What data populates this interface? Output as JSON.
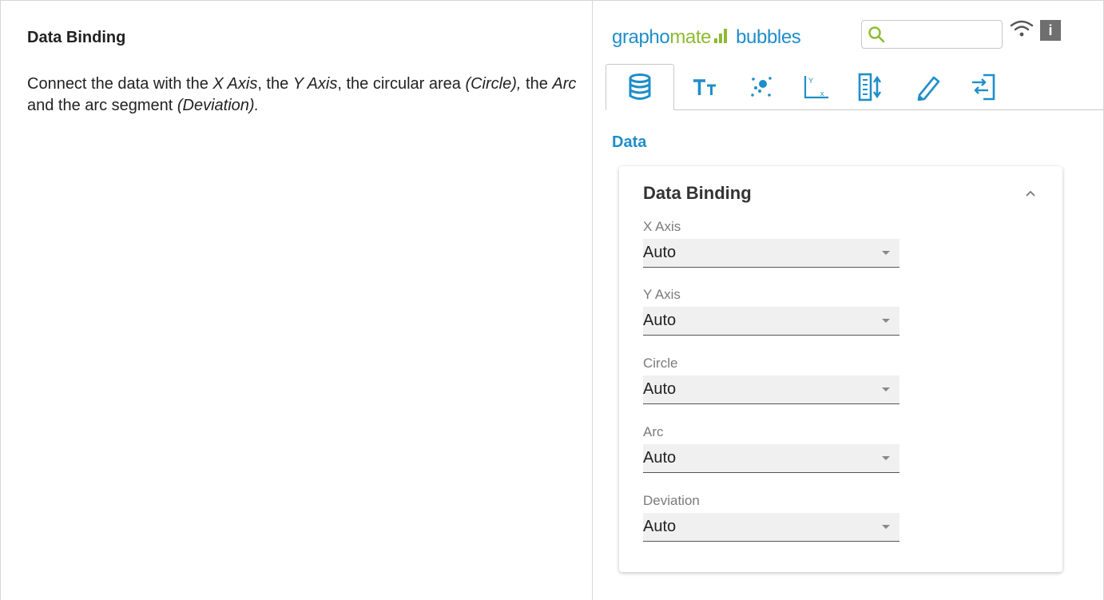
{
  "left": {
    "title": "Data Binding",
    "desc": {
      "t1": "Connect the data with the ",
      "x_axis": "X Axis",
      "t2": ", the ",
      "y_axis": "Y Axis",
      "t3": ", the circular area ",
      "circle": "(Circle),",
      "t4": " the ",
      "arc": "Arc",
      "t5": " and the arc segment ",
      "deviation": "(Deviation)."
    }
  },
  "brand": {
    "part1": "grapho",
    "part2": "mate",
    "part3": "bubbles"
  },
  "search": {
    "value": ""
  },
  "info_label": "i",
  "tabs": [
    {
      "name": "data",
      "icon": "database-icon",
      "active": true
    },
    {
      "name": "text",
      "icon": "text-size-icon",
      "active": false
    },
    {
      "name": "bubbles",
      "icon": "scatter-dots-icon",
      "active": false
    },
    {
      "name": "axis",
      "icon": "axis-icon",
      "active": false
    },
    {
      "name": "sort",
      "icon": "sort-icon",
      "active": false
    },
    {
      "name": "style",
      "icon": "pencil-icon",
      "active": false
    },
    {
      "name": "export",
      "icon": "export-icon",
      "active": false
    }
  ],
  "section_title": "Data",
  "card": {
    "title": "Data Binding",
    "fields": [
      {
        "label": "X Axis",
        "value": "Auto"
      },
      {
        "label": "Y Axis",
        "value": "Auto"
      },
      {
        "label": "Circle",
        "value": "Auto"
      },
      {
        "label": "Arc",
        "value": "Auto"
      },
      {
        "label": "Deviation",
        "value": "Auto"
      }
    ]
  },
  "colors": {
    "accent_blue": "#1f8ec9",
    "accent_green": "#8dbb32",
    "info_bg": "#6f6f6f"
  }
}
